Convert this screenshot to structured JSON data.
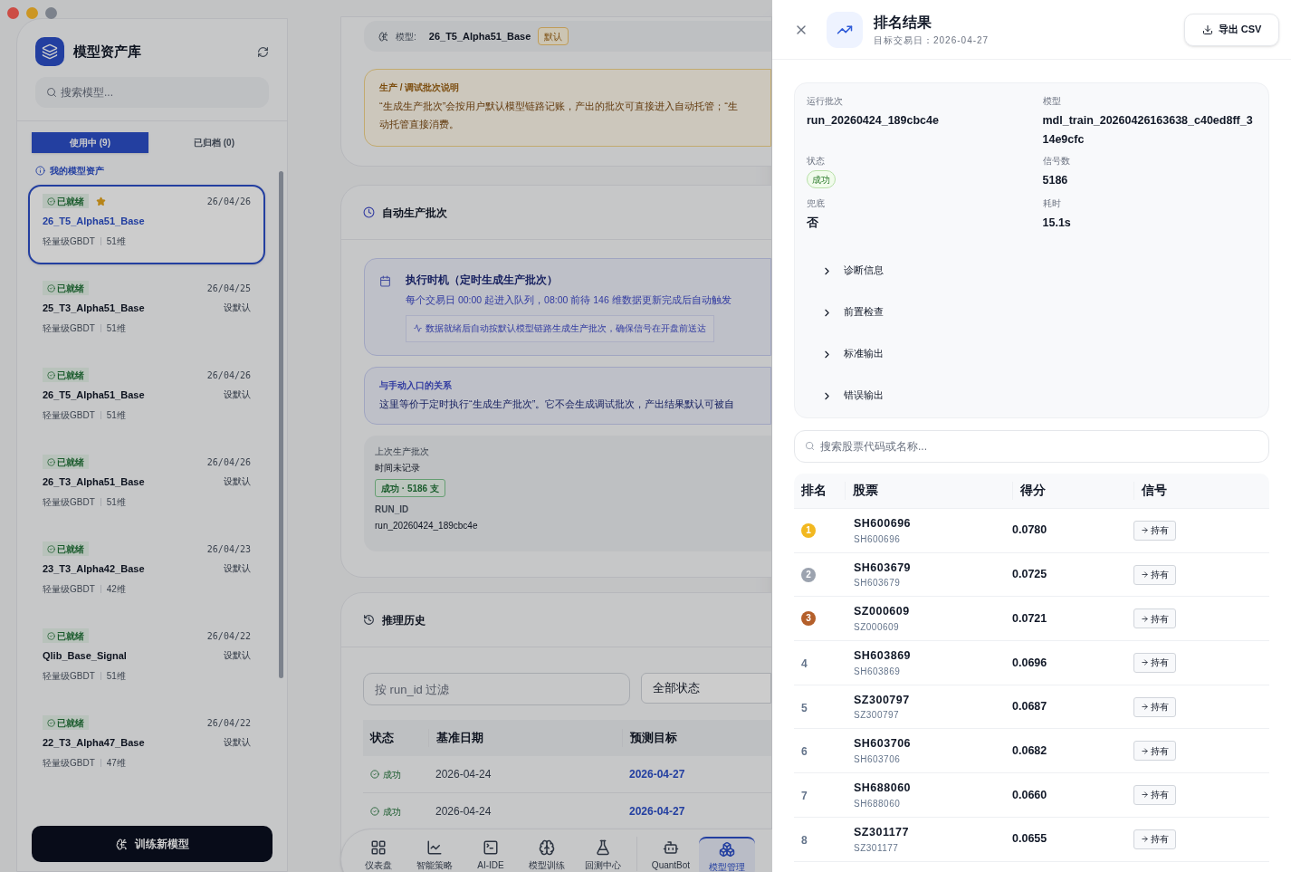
{
  "sidebar": {
    "title": "模型资产库",
    "search": {
      "placeholder": "搜索模型..."
    },
    "tabs": [
      {
        "label": "使用中 (9)",
        "selected": true
      },
      {
        "label": "已归档 (0)",
        "selected": false
      }
    ],
    "section": "我的模型资产",
    "models": [
      {
        "status": "已就绪",
        "date": "26/04/26",
        "name": "26_T5_Alpha51_Base",
        "type": "轻量级GBDT",
        "dims": "51维",
        "selected": true,
        "is_default": true
      },
      {
        "status": "已就绪",
        "date": "26/04/25",
        "name": "25_T3_Alpha51_Base",
        "type": "轻量级GBDT",
        "dims": "51维",
        "selected": false,
        "is_default": false,
        "action": "设默认"
      },
      {
        "status": "已就绪",
        "date": "26/04/26",
        "name": "26_T5_Alpha51_Base",
        "type": "轻量级GBDT",
        "dims": "51维",
        "selected": false,
        "is_default": false,
        "action": "设默认"
      },
      {
        "status": "已就绪",
        "date": "26/04/26",
        "name": "26_T3_Alpha51_Base",
        "type": "轻量级GBDT",
        "dims": "51维",
        "selected": false,
        "is_default": false,
        "action": "设默认"
      },
      {
        "status": "已就绪",
        "date": "26/04/23",
        "name": "23_T3_Alpha42_Base",
        "type": "轻量级GBDT",
        "dims": "42维",
        "selected": false,
        "is_default": false,
        "action": "设默认"
      },
      {
        "status": "已就绪",
        "date": "26/04/22",
        "name": "Qlib_Base_Signal",
        "type": "轻量级GBDT",
        "dims": "51维",
        "selected": false,
        "is_default": false,
        "action": "设默认"
      },
      {
        "status": "已就绪",
        "date": "26/04/22",
        "name": "22_T3_Alpha47_Base",
        "type": "轻量级GBDT",
        "dims": "47维",
        "selected": false,
        "is_default": false,
        "action": "设默认"
      }
    ],
    "train_button": "训练新模型"
  },
  "main": {
    "model_bar": {
      "label": "模型:",
      "name": "26_T5_Alpha51_Base",
      "badge": "默认"
    },
    "notice": {
      "title": "生产 / 调试批次说明",
      "lines": [
        "“生成生产批次”会按用户默认模型链路记账，产出的批次可直接进入自动托管；“生",
        "动托管直接消费。"
      ]
    },
    "auto_batch": {
      "title": "自动生产批次",
      "schedule": {
        "title": "执行时机（定时生成生产批次）",
        "desc": "每个交易日 00:00 起进入队列，08:00 前待 146 维数据更新完成后自动触发",
        "note": "数据就绪后自动按默认模型链路生成生产批次，确保信号在开盘前送达"
      },
      "relation": {
        "title": "与手动入口的关系",
        "text": "这里等价于定时执行“生成生产批次”。它不会生成调试批次，产出结果默认可被自"
      },
      "last": {
        "label": "上次生产批次",
        "time": "时间未记录",
        "badge": "成功 · 5186 支",
        "id_label": "RUN_ID",
        "id": "run_20260424_189cbc4e"
      }
    },
    "history": {
      "title": "推理历史",
      "filter_placeholder": "按 run_id 过滤",
      "status_select": "全部状态",
      "columns": [
        "状态",
        "基准日期",
        "预测目标"
      ],
      "rows": [
        {
          "status": "成功",
          "date": "2026-04-24",
          "target": "2026-04-27"
        },
        {
          "status": "成功",
          "date": "2026-04-24",
          "target": "2026-04-27"
        }
      ]
    },
    "nav": [
      {
        "label": "仪表盘",
        "kind": "grid",
        "selected": false
      },
      {
        "label": "智能策略",
        "kind": "chart",
        "selected": false
      },
      {
        "label": "AI-IDE",
        "kind": "terminal",
        "selected": false
      },
      {
        "label": "模型训练",
        "kind": "brain",
        "selected": false
      },
      {
        "label": "回测中心",
        "kind": "flask",
        "selected": false
      },
      {
        "label": "QuantBot",
        "kind": "bot",
        "selected": false
      },
      {
        "label": "模型管理",
        "kind": "boxes",
        "selected": true
      }
    ]
  },
  "drawer": {
    "title": "排名结果",
    "subtitle": "目标交易日：2026-04-27",
    "export": "导出 CSV",
    "fields": [
      {
        "label": "运行批次",
        "value": "run_20260424_189cbc4e",
        "kind": "text"
      },
      {
        "label": "模型",
        "value": "mdl_train_20260426163638_c40ed8ff_314e9cfc",
        "kind": "text"
      },
      {
        "label": "状态",
        "value": "成功",
        "kind": "badge"
      },
      {
        "label": "信号数",
        "value": "5186",
        "kind": "text"
      },
      {
        "label": "兜底",
        "value": "否",
        "kind": "text"
      },
      {
        "label": "耗时",
        "value": "15.1s",
        "kind": "text"
      }
    ],
    "sections": [
      {
        "label": "诊断信息",
        "expanded": false
      },
      {
        "label": "前置检查",
        "expanded": false
      },
      {
        "label": "标准输出",
        "expanded": false
      },
      {
        "label": "错误输出",
        "expanded": false
      }
    ],
    "search": {
      "placeholder": "搜索股票代码或名称..."
    },
    "columns": [
      "排名",
      "股票",
      "得分",
      "信号"
    ],
    "rows": [
      {
        "rank": "1",
        "kind": "medal",
        "color": "#f2b820",
        "code": "SH600696",
        "sub": "SH600696",
        "score": "0.0780",
        "signal": "持有"
      },
      {
        "rank": "2",
        "kind": "medal",
        "color": "#9ca3af",
        "code": "SH603679",
        "sub": "SH603679",
        "score": "0.0725",
        "signal": "持有"
      },
      {
        "rank": "3",
        "kind": "medal",
        "color": "#b45f2a",
        "code": "SZ000609",
        "sub": "SZ000609",
        "score": "0.0721",
        "signal": "持有"
      },
      {
        "rank": "4",
        "kind": "plain",
        "code": "SH603869",
        "sub": "SH603869",
        "score": "0.0696",
        "signal": "持有"
      },
      {
        "rank": "5",
        "kind": "plain",
        "code": "SZ300797",
        "sub": "SZ300797",
        "score": "0.0687",
        "signal": "持有"
      },
      {
        "rank": "6",
        "kind": "plain",
        "code": "SH603706",
        "sub": "SH603706",
        "score": "0.0682",
        "signal": "持有"
      },
      {
        "rank": "7",
        "kind": "plain",
        "code": "SH688060",
        "sub": "SH688060",
        "score": "0.0660",
        "signal": "持有"
      },
      {
        "rank": "8",
        "kind": "plain",
        "code": "SZ301177",
        "sub": "SZ301177",
        "score": "0.0655",
        "signal": "持有"
      }
    ]
  }
}
